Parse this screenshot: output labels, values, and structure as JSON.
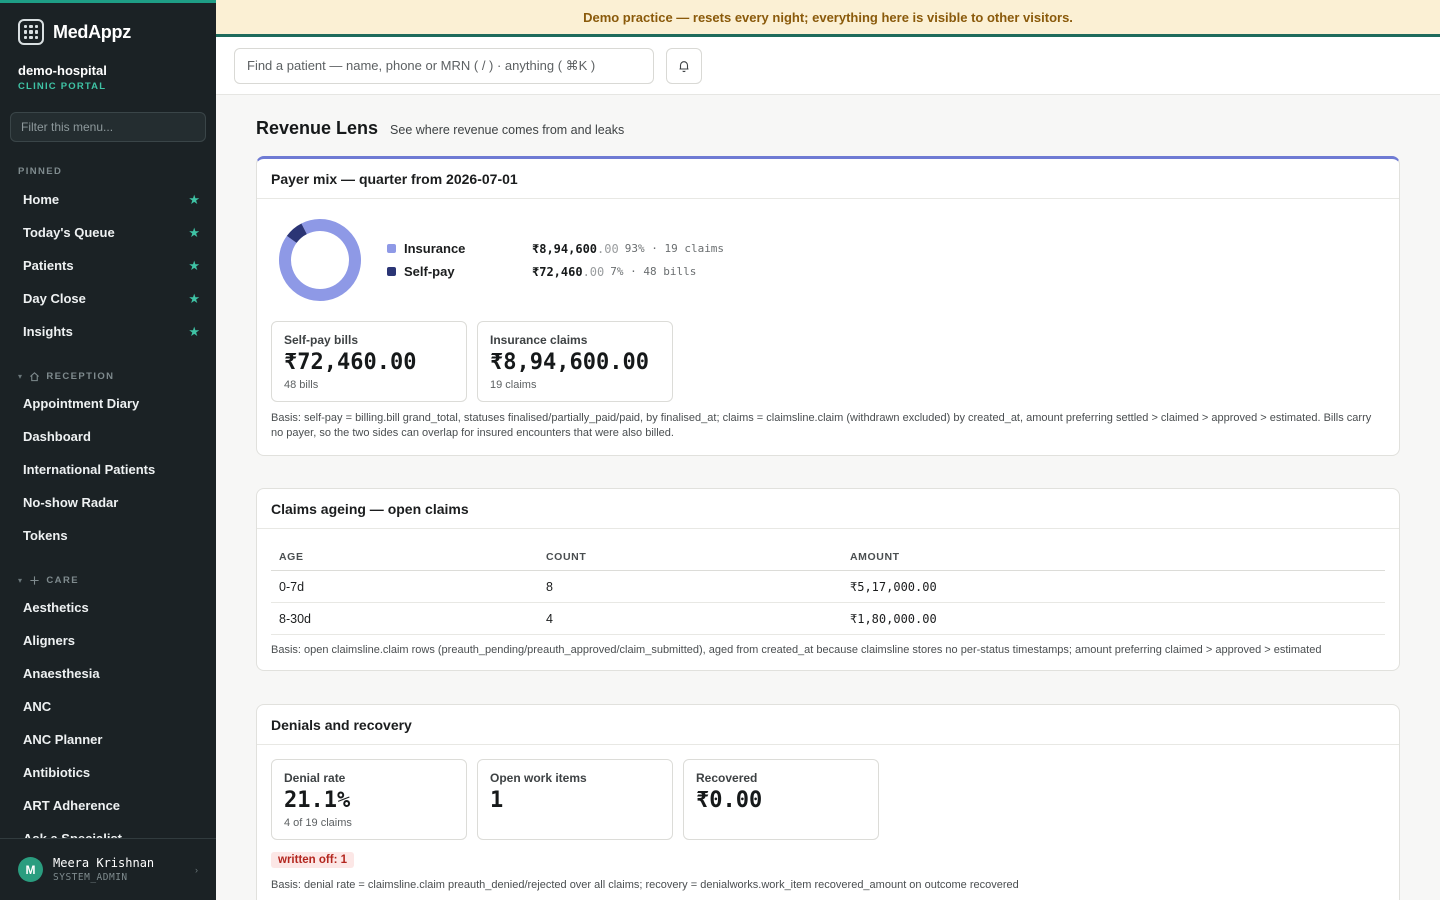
{
  "brand": {
    "name": "MedAppz"
  },
  "tenant": {
    "name": "demo-hospital",
    "sub": "CLINIC PORTAL"
  },
  "menu_filter": {
    "placeholder": "Filter this menu..."
  },
  "sections": {
    "pinned": "PINNED",
    "reception": "RECEPTION",
    "care": "CARE"
  },
  "pinned_items": [
    "Home",
    "Today's Queue",
    "Patients",
    "Day Close",
    "Insights"
  ],
  "reception_items": [
    "Appointment Diary",
    "Dashboard",
    "International Patients",
    "No-show Radar",
    "Tokens"
  ],
  "care_items": [
    "Aesthetics",
    "Aligners",
    "Anaesthesia",
    "ANC",
    "ANC Planner",
    "Antibiotics",
    "ART Adherence",
    "Ask a Specialist"
  ],
  "user": {
    "initial": "M",
    "name": "Meera Krishnan",
    "role": "SYSTEM_ADMIN"
  },
  "banner": "Demo practice — resets every night; everything here is visible to other visitors.",
  "search": {
    "placeholder": "Find a patient — name, phone or MRN ( / ) · anything ( ⌘K )"
  },
  "page": {
    "title": "Revenue Lens",
    "subtitle": "See where revenue comes from and leaks"
  },
  "payer_mix": {
    "title": "Payer mix — quarter from 2026-07-01",
    "legend": [
      {
        "name": "Insurance",
        "amount_main": "₹8,94,600",
        "amount_dec": ".00",
        "meta": "93% · 19 claims",
        "color": "#8e99e6"
      },
      {
        "name": "Self-pay",
        "amount_main": "₹72,460",
        "amount_dec": ".00",
        "meta": "7% · 48 bills",
        "color": "#2b3575"
      }
    ],
    "stats": [
      {
        "label": "Self-pay bills",
        "value": "₹72,460.00",
        "meta": "48 bills"
      },
      {
        "label": "Insurance claims",
        "value": "₹8,94,600.00",
        "meta": "19 claims"
      }
    ],
    "basis": "Basis: self-pay = billing.bill grand_total, statuses finalised/partially_paid/paid, by finalised_at; claims = claimsline.claim (withdrawn excluded) by created_at, amount preferring settled > claimed > approved > estimated. Bills carry no payer, so the two sides can overlap for insured encounters that were also billed."
  },
  "chart_data": {
    "type": "pie",
    "categories": [
      "Insurance",
      "Self-pay"
    ],
    "values": [
      894600,
      72460
    ]
  },
  "claims_ageing": {
    "title": "Claims ageing — open claims",
    "columns": [
      "AGE",
      "COUNT",
      "AMOUNT"
    ],
    "rows": [
      [
        "0-7d",
        "8",
        "₹5,17,000.00"
      ],
      [
        "8-30d",
        "4",
        "₹1,80,000.00"
      ]
    ],
    "basis": "Basis: open claimsline.claim rows (preauth_pending/preauth_approved/claim_submitted), aged from created_at because claimsline stores no per-status timestamps; amount preferring claimed > approved > estimated"
  },
  "denials": {
    "title": "Denials and recovery",
    "stats": [
      {
        "label": "Denial rate",
        "value": "21.1%",
        "meta": "4 of 19 claims"
      },
      {
        "label": "Open work items",
        "value": "1",
        "meta": ""
      },
      {
        "label": "Recovered",
        "value": "₹0.00",
        "meta": ""
      }
    ],
    "badge": "written off: 1",
    "basis": "Basis: denial rate = claimsline.claim preauth_denied/rejected over all claims; recovery = denialworks.work_item recovered_amount on outcome recovered"
  }
}
